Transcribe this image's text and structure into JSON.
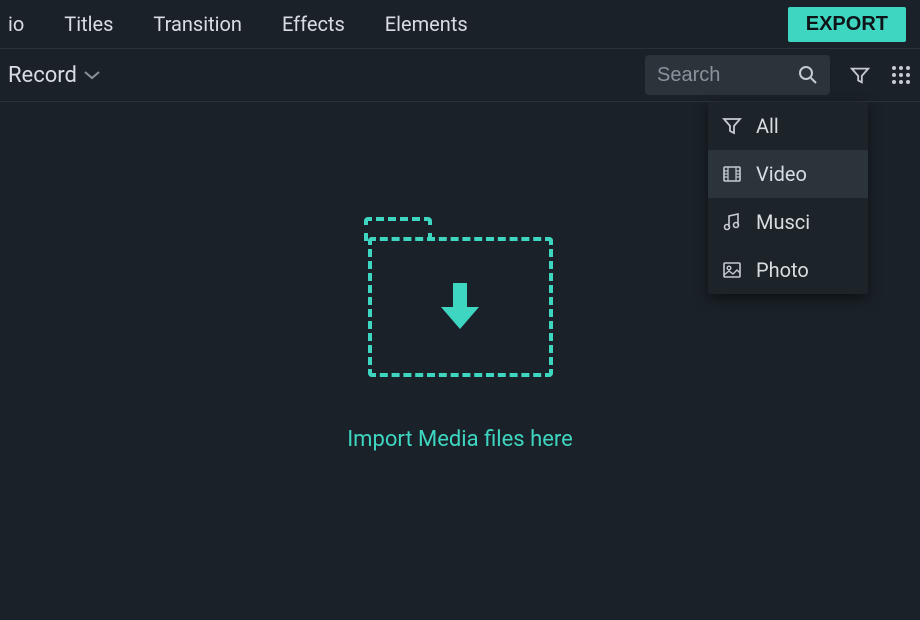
{
  "nav": {
    "items": [
      "io",
      "Titles",
      "Transition",
      "Effects",
      "Elements"
    ],
    "export": "EXPORT"
  },
  "toolbar": {
    "record": "Record",
    "search_placeholder": "Search"
  },
  "import": {
    "label": "Import Media files here"
  },
  "filter_menu": {
    "items": [
      {
        "label": "All",
        "icon": "filter-icon"
      },
      {
        "label": "Video",
        "icon": "video-icon"
      },
      {
        "label": "Musci",
        "icon": "music-icon"
      },
      {
        "label": "Photo",
        "icon": "photo-icon"
      }
    ],
    "selected_index": 1
  },
  "colors": {
    "accent": "#3ed6c0",
    "bg": "#1a2128",
    "panel": "#2b333b"
  }
}
